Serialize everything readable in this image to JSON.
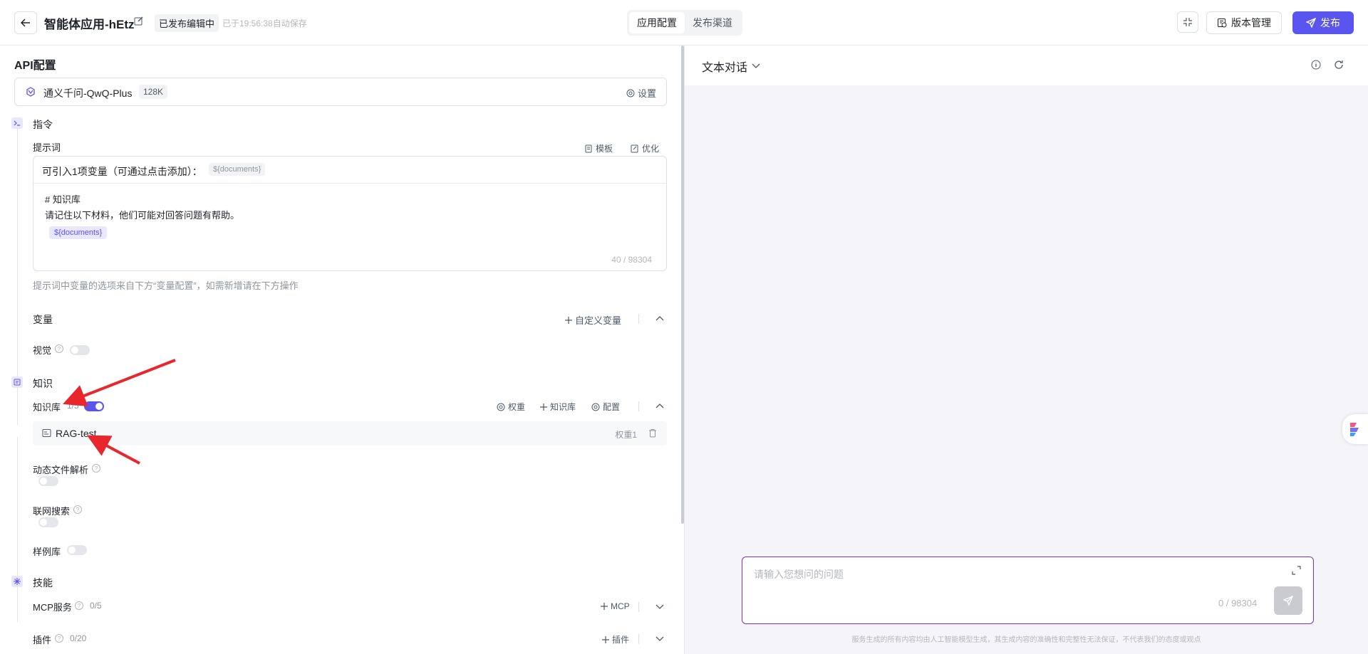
{
  "header": {
    "app_title": "智能体应用-hEtz",
    "status": "已发布编辑中",
    "autosave": "已于19:56:38自动保存",
    "tabs": [
      {
        "label": "应用配置",
        "active": true
      },
      {
        "label": "发布渠道",
        "active": false
      }
    ],
    "version_label": "版本管理",
    "publish_label": "发布",
    "accent_color": "#5b55f0"
  },
  "left": {
    "api_title": "API配置",
    "model": {
      "name": "通义千问-QwQ-Plus",
      "context": "128K",
      "settings_label": "设置"
    },
    "instruction": {
      "title": "指令",
      "prompt_label": "提示词",
      "template_label": "模板",
      "optimize_label": "优化",
      "variables_intro": "可引入1项变量（可通过点击添加）：",
      "variable_tag": "${documents}",
      "body_line1": "# 知识库",
      "body_line2": "请记住以下材料，他们可能对回答问题有帮助。",
      "body_tag": "${documents}",
      "counter": "40 / 98304",
      "hint": "提示词中变量的选项来自下方“变量配置”，如需新增请在下方操作"
    },
    "variables": {
      "title": "变量",
      "add_label": "自定义变量"
    },
    "vision": {
      "label": "视觉",
      "enabled": false
    },
    "knowledge": {
      "title": "知识",
      "kb_label": "知识库",
      "kb_count": "1/5",
      "kb_enabled": true,
      "weight_label": "权重",
      "add_label": "知识库",
      "config_label": "配置",
      "items": [
        {
          "name": "RAG-test",
          "weight": "权重1"
        }
      ]
    },
    "dynamic_file": {
      "label": "动态文件解析",
      "enabled": false
    },
    "web_search": {
      "label": "联网搜索",
      "enabled": false
    },
    "examples": {
      "label": "样例库",
      "enabled": false
    },
    "skills": {
      "title": "技能",
      "mcp_label": "MCP服务",
      "mcp_count": "0/5",
      "mcp_add": "MCP",
      "plugin_label": "插件",
      "plugin_count": "0/20",
      "plugin_add": "插件"
    }
  },
  "right": {
    "mode_label": "文本对话",
    "input_placeholder": "请输入您想问的问题",
    "input_counter": "0 / 98304",
    "disclaimer": "服务生成的所有内容均由人工智能模型生成，其生成内容的准确性和完整性无法保证，不代表我们的态度或观点"
  }
}
